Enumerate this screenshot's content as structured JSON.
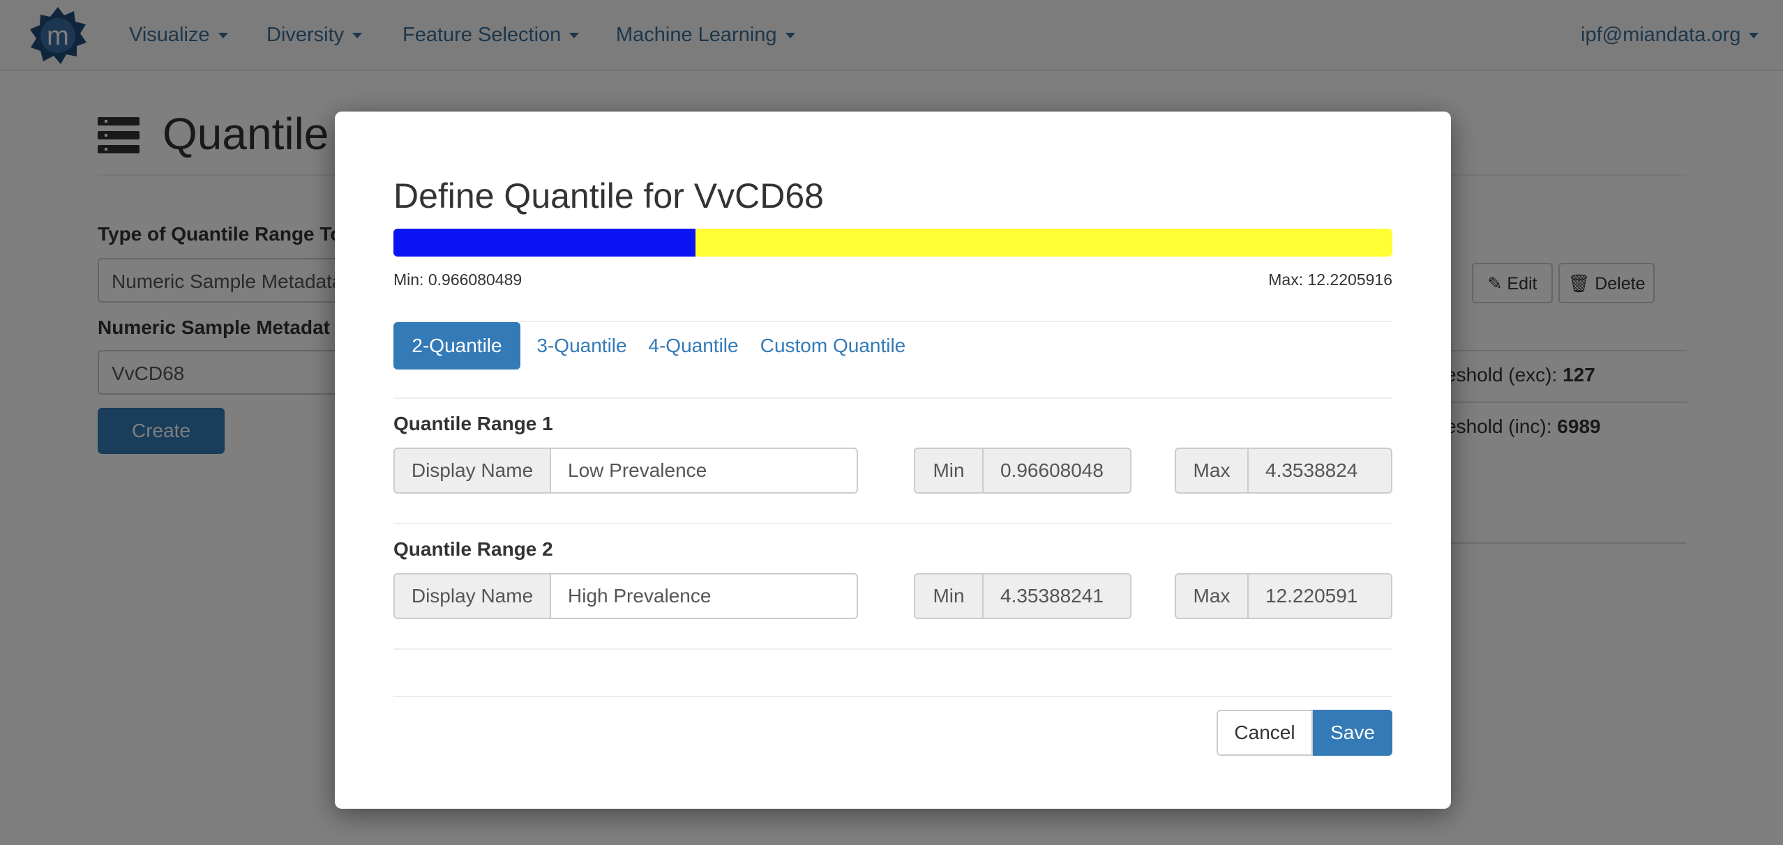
{
  "navbar": {
    "items": [
      "Visualize",
      "Diversity",
      "Feature Selection",
      "Machine Learning"
    ],
    "user": "ipf@miandata.org"
  },
  "page": {
    "title": "Quantile",
    "type_label": "Type of Quantile Range To",
    "type_value": "Numeric Sample Metadata",
    "metadata_label": "Numeric Sample Metadat",
    "metadata_value": "VvCD68",
    "create_label": "Create",
    "edit_label": "Edit",
    "delete_label": "Delete",
    "threshold_exc_label": "eshold (exc): ",
    "threshold_exc_value": "127",
    "threshold_inc_label": "eshold (inc): ",
    "threshold_inc_value": "6989"
  },
  "modal": {
    "title": "Define Quantile for VvCD68",
    "min_text": "Min: 0.966080489",
    "max_text": "Max: 12.2205916",
    "bar": {
      "segments": [
        {
          "color": "#0a14f5",
          "fraction": 0.3023
        },
        {
          "color": "#ffff33",
          "fraction": 0.6977
        }
      ]
    },
    "tabs": [
      "2-Quantile",
      "3-Quantile",
      "4-Quantile",
      "Custom Quantile"
    ],
    "active_tab": "2-Quantile",
    "display_name_addon": "Display Name",
    "min_addon": "Min",
    "max_addon": "Max",
    "ranges": [
      {
        "label": "Quantile Range 1",
        "display_name": "Low Prevalence",
        "min": "0.96608048",
        "max": "4.3538824"
      },
      {
        "label": "Quantile Range 2",
        "display_name": "High Prevalence",
        "min": "4.35388241",
        "max": "12.220591"
      }
    ],
    "cancel_label": "Cancel",
    "save_label": "Save"
  },
  "colors": {
    "primary": "#337ab7",
    "link": "#337ab7",
    "backdrop": "rgba(0,0,0,0.5)"
  }
}
